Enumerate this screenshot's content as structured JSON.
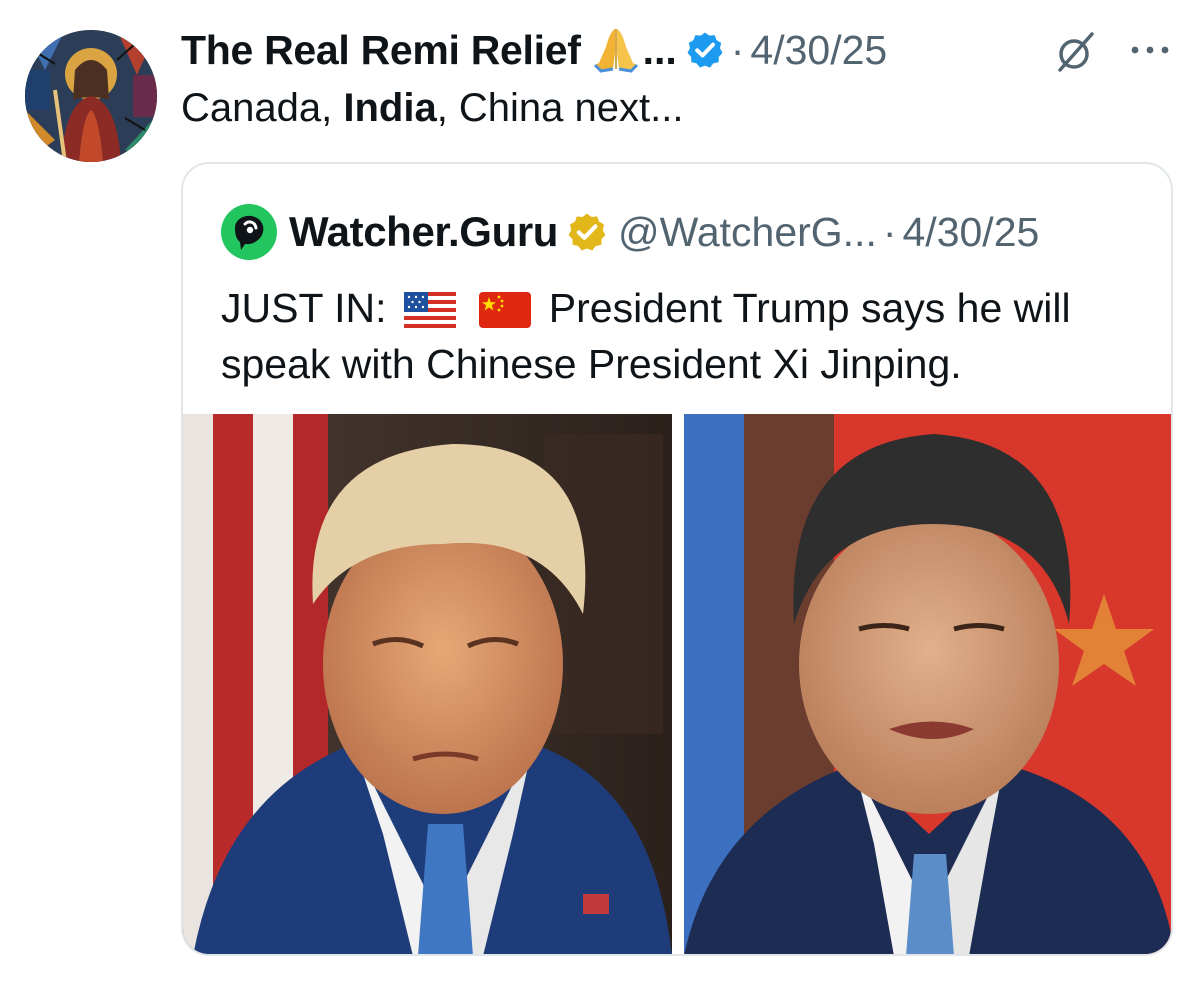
{
  "tweet": {
    "author_name": "The Real Remi Relief",
    "truncation": "...",
    "separator": "·",
    "date": "4/30/25",
    "text_parts": [
      "Canada, ",
      "India",
      ", China next..."
    ]
  },
  "quote": {
    "author_name": "Watcher.Guru",
    "handle": "@WatcherG...",
    "separator": "·",
    "date": "4/30/25",
    "text_prefix": "JUST IN:",
    "text_main": "President Trump says he will speak with Chinese President Xi Jinping.",
    "flags": [
      "us-flag-icon",
      "china-flag-icon"
    ]
  },
  "icons": {
    "verified": "verified-badge-icon",
    "gold_badge": "gold-verified-badge-icon",
    "grok": "grok-icon",
    "more": "more-options-icon",
    "emoji": "folded-hands-emoji-icon"
  },
  "colors": {
    "verified_blue": "#1d9bf0",
    "gold": "#e2b719",
    "text": "#0f1419",
    "muted": "#536471",
    "watcher_green": "#22c55e"
  }
}
